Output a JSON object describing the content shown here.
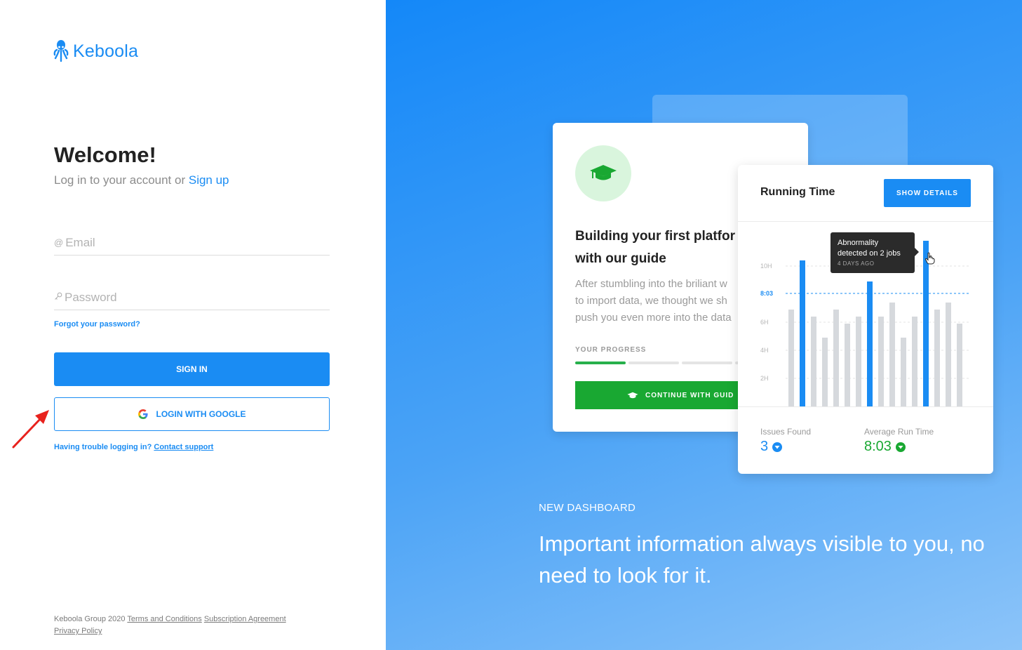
{
  "brand": {
    "name": "Keboola",
    "color": "#1a8cf3"
  },
  "login": {
    "title": "Welcome!",
    "subtitle_prefix": "Log in to your account or",
    "signup_link": "Sign up",
    "email_placeholder": "Email",
    "email_icon": "@",
    "password_placeholder": "Password",
    "forgot_link": "Forgot your password?",
    "signin_label": "SIGN IN",
    "google_label": "LOGIN WITH GOOGLE",
    "trouble_text": "Having trouble logging in?",
    "contact_link": "Contact support"
  },
  "footer": {
    "copyright": "Keboola Group 2020",
    "links": [
      "Terms and Conditions",
      "Subscription Agreement",
      "Privacy Policy"
    ]
  },
  "promo": {
    "guide_card": {
      "title_line1": "Building your first platfor",
      "title_line2": "with our guide",
      "text_lines": [
        "After stumbling into the briliant w",
        "to import data, we thought we sh",
        "push you even more into the data"
      ],
      "progress_label": "YOUR PROGRESS",
      "progress_fraction": 0.25,
      "continue_label": "CONTINUE WITH GUID"
    },
    "running_card": {
      "title": "Running Time",
      "button_label": "SHOW DETAILS",
      "tooltip_title": "Abnormality detected on 2 jobs",
      "tooltip_title_line1": "Abnormality",
      "tooltip_title_line2": "detected on 2 jobs",
      "tooltip_time": "4 DAYS AGO",
      "issues_label": "Issues Found",
      "issues_value": "3",
      "avg_label": "Average Run Time",
      "avg_value": "8:03"
    },
    "eyebrow": "NEW DASHBOARD",
    "headline": "Important information always visible to you, no need to look for it."
  },
  "chart_data": {
    "type": "bar",
    "title": "Running Time",
    "y_ticks": [
      "2H",
      "4H",
      "6H",
      "8:03",
      "10H"
    ],
    "ylim": [
      0,
      11
    ],
    "reference_line": 8.05,
    "values": [
      6.9,
      10.4,
      6.4,
      4.9,
      6.9,
      5.9,
      6.4,
      8.9,
      6.4,
      7.4,
      4.9,
      6.4,
      11.8,
      6.9,
      7.4,
      5.9
    ],
    "highlighted": [
      false,
      true,
      false,
      false,
      false,
      false,
      false,
      true,
      false,
      false,
      false,
      false,
      true,
      false,
      false,
      false
    ],
    "colors": {
      "normal": "#d6d9dd",
      "highlight": "#1a8cf3",
      "reference": "#1a8cf3"
    }
  }
}
